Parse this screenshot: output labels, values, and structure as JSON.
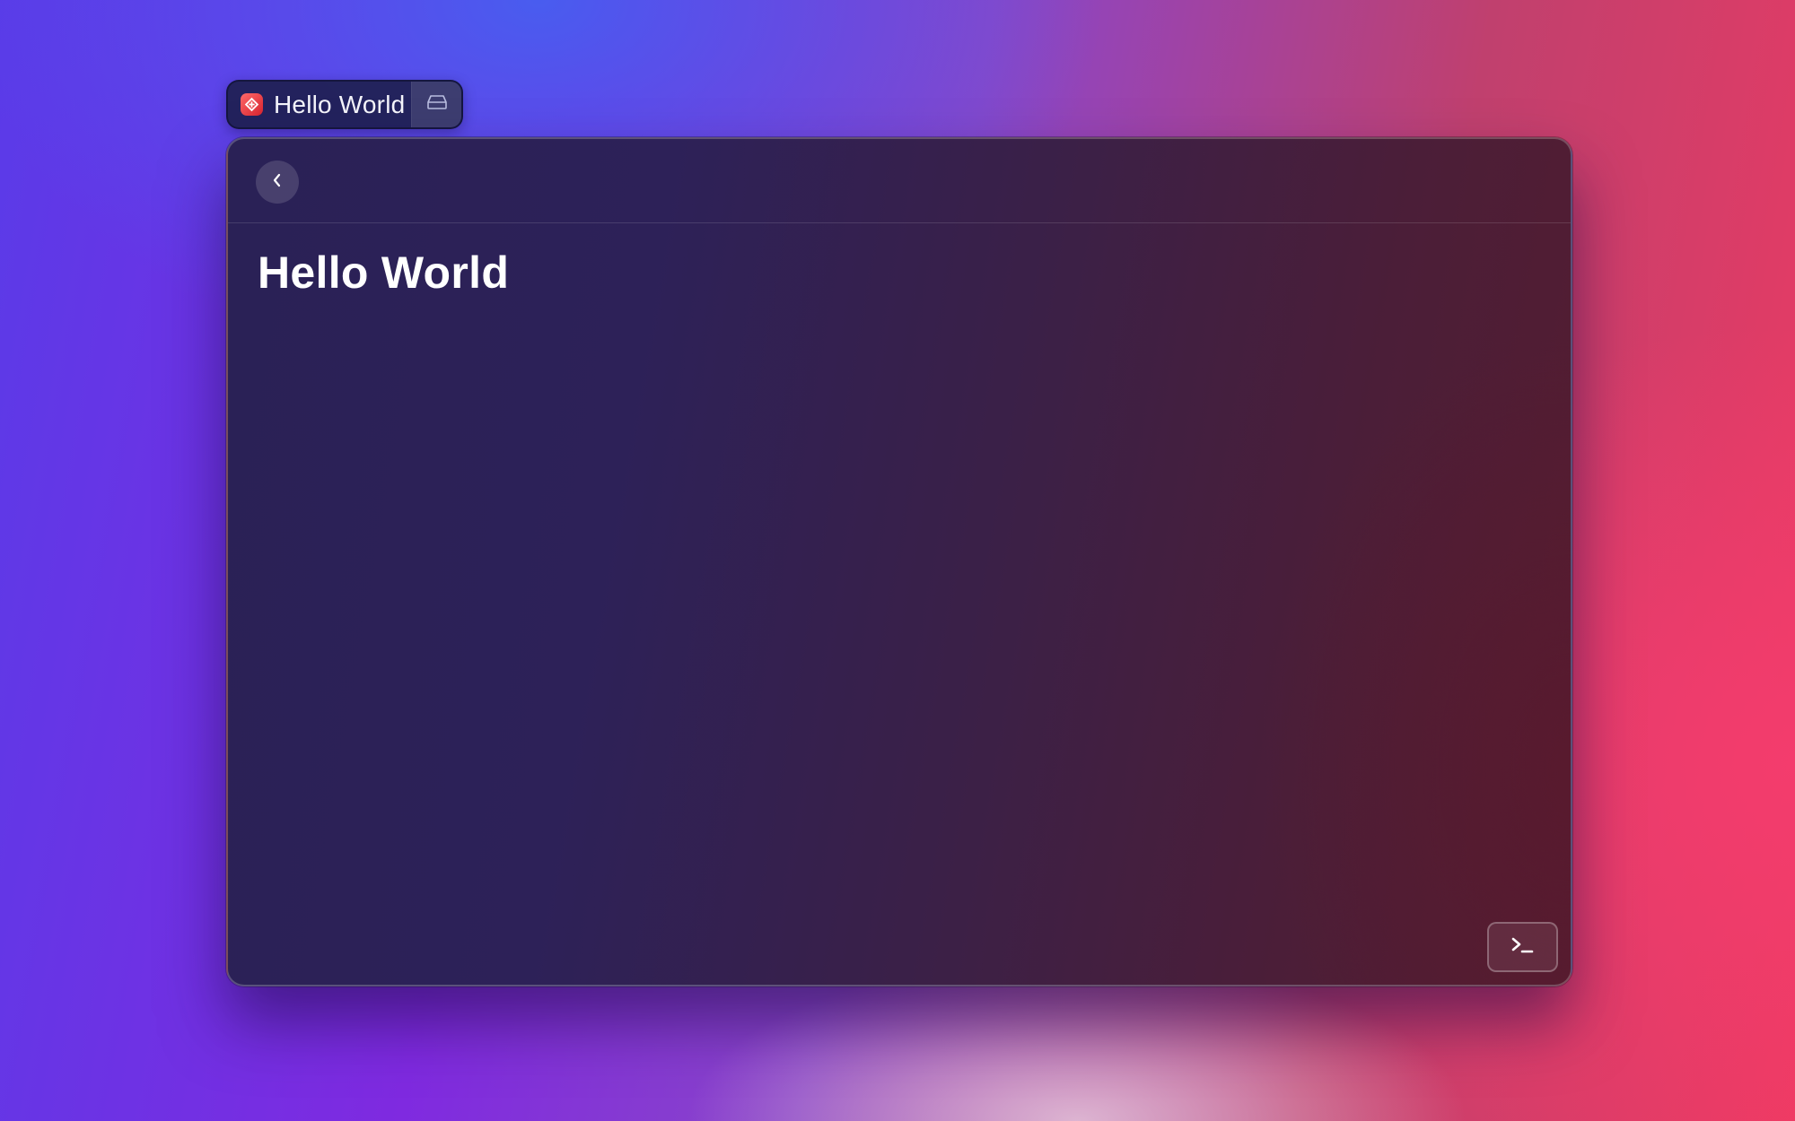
{
  "tab": {
    "title": "Hello World",
    "app_icon": "app-logo-icon",
    "action_icon": "drive-icon"
  },
  "window": {
    "back_icon": "chevron-left-icon",
    "page_title": "Hello World",
    "terminal_icon": "terminal-icon"
  },
  "colors": {
    "app_icon_accent": "#e83a3f",
    "window_bg_left": "#2a2156",
    "window_bg_right": "#551c30",
    "text": "#ffffff"
  }
}
